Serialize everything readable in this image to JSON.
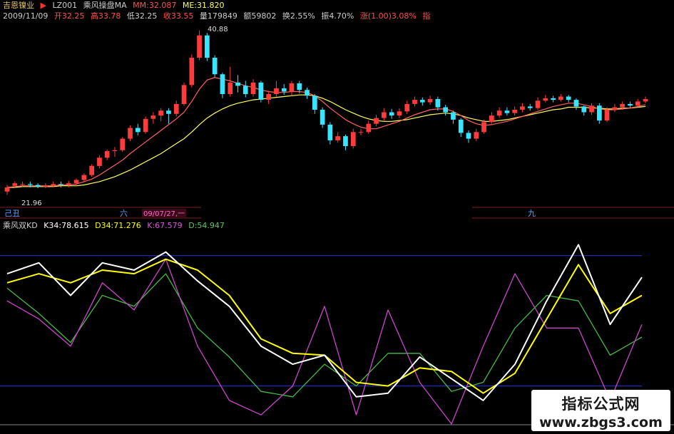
{
  "header": {
    "app": "吉恩镍业",
    "arrow": "▶",
    "code": "LZ001",
    "indicator": "乘风操盘MA",
    "mm": "MM:32.087",
    "me": "ME:31.820",
    "date": "2009/11/09",
    "open": "开32.25",
    "high": "高33.78",
    "low": "低32.25",
    "close": "收33.55",
    "volume": "量179849",
    "amount": "额59802",
    "turnover": "换2.55%",
    "amplitude": "振4.70%",
    "change": "涨(1.00)3.08%",
    "more": "指"
  },
  "price_panel": {
    "high_label": "40.88",
    "low_label": "21.96"
  },
  "separator": {
    "left": "己丑",
    "mid": "六",
    "date_tag": "09/07/27,一",
    "right": "九"
  },
  "kd_header": {
    "name": "乘风双KD",
    "k34": "K34:78.615",
    "d34": "D34:71.276",
    "k": "K:67.579",
    "d": "D:54.947"
  },
  "watermark": {
    "title": "指标公式网",
    "url": "www.zbgs3.com"
  },
  "colors": {
    "up": "#ff3b3b",
    "down": "#39e4ff",
    "ma_fast": "#ff6060",
    "ma_slow": "#ffff60",
    "k34": "#ffffff",
    "d34": "#ffff00",
    "k": "#cc44cc",
    "d": "#44bb44",
    "ref_line": "#1e2bb0"
  },
  "chart_data": [
    {
      "type": "candlestick",
      "title": "乘风操盘MA",
      "ylim": [
        20,
        42
      ],
      "ohlc": [
        [
          21.4,
          21.9,
          21.0,
          22.2
        ],
        [
          22.1,
          22.4,
          21.8,
          22.6
        ],
        [
          22.3,
          22.3,
          22.0,
          22.6
        ],
        [
          22.3,
          22.2,
          21.9,
          22.6
        ],
        [
          22.2,
          22.0,
          21.8,
          22.4
        ],
        [
          22.0,
          22.1,
          21.8,
          22.4
        ],
        [
          22.1,
          22.3,
          21.9,
          22.6
        ],
        [
          22.3,
          22.2,
          21.9,
          22.6
        ],
        [
          22.2,
          22.4,
          21.9,
          22.7
        ],
        [
          22.4,
          22.8,
          22.1,
          23.0
        ],
        [
          22.8,
          23.4,
          22.5,
          23.6
        ],
        [
          23.4,
          24.5,
          23.2,
          24.7
        ],
        [
          24.5,
          25.5,
          24.2,
          25.8
        ],
        [
          25.5,
          26.3,
          25.2,
          26.5
        ],
        [
          26.3,
          26.4,
          25.6,
          26.8
        ],
        [
          26.4,
          27.8,
          26.2,
          28.0
        ],
        [
          27.8,
          29.1,
          27.5,
          29.4
        ],
        [
          29.1,
          28.6,
          28.2,
          29.6
        ],
        [
          28.6,
          30.2,
          28.4,
          30.5
        ],
        [
          30.2,
          30.6,
          29.6,
          31.0
        ],
        [
          30.6,
          31.2,
          29.9,
          31.5
        ],
        [
          31.2,
          30.8,
          29.6,
          31.5
        ],
        [
          30.8,
          32.0,
          30.5,
          32.4
        ],
        [
          32.0,
          34.3,
          31.8,
          34.6
        ],
        [
          34.3,
          37.6,
          34.0,
          38.0
        ],
        [
          37.6,
          40.3,
          37.3,
          40.9
        ],
        [
          40.3,
          37.6,
          37.2,
          40.6
        ],
        [
          37.6,
          35.6,
          35.2,
          37.9
        ],
        [
          35.6,
          33.2,
          32.7,
          35.8
        ],
        [
          33.2,
          34.6,
          32.9,
          36.5
        ],
        [
          34.6,
          34.2,
          33.4,
          35.5
        ],
        [
          34.2,
          33.2,
          32.8,
          34.8
        ],
        [
          33.2,
          34.6,
          32.9,
          35.0
        ],
        [
          34.6,
          32.5,
          32.2,
          34.8
        ],
        [
          32.5,
          33.2,
          32.0,
          33.6
        ],
        [
          33.2,
          33.9,
          32.9,
          34.8
        ],
        [
          33.9,
          33.5,
          33.1,
          34.4
        ],
        [
          33.5,
          34.5,
          33.0,
          34.8
        ],
        [
          34.5,
          33.7,
          33.3,
          34.8
        ],
        [
          33.7,
          33.0,
          32.6,
          34.0
        ],
        [
          33.0,
          31.3,
          30.8,
          33.2
        ],
        [
          31.3,
          29.5,
          29.1,
          31.6
        ],
        [
          29.5,
          27.6,
          27.1,
          29.8
        ],
        [
          27.6,
          28.1,
          27.3,
          28.6
        ],
        [
          28.1,
          26.9,
          26.4,
          28.3
        ],
        [
          26.9,
          28.6,
          26.6,
          29.0
        ],
        [
          28.6,
          28.6,
          28.2,
          29.0
        ],
        [
          28.6,
          29.6,
          28.4,
          30.0
        ],
        [
          29.6,
          30.3,
          29.3,
          30.7
        ],
        [
          30.3,
          31.0,
          30.0,
          31.5
        ],
        [
          31.0,
          30.6,
          30.2,
          31.4
        ],
        [
          30.6,
          31.1,
          30.3,
          31.5
        ],
        [
          31.1,
          32.0,
          30.8,
          32.4
        ],
        [
          32.0,
          32.5,
          31.7,
          32.9
        ],
        [
          32.5,
          32.2,
          31.8,
          32.8
        ],
        [
          32.2,
          32.6,
          31.9,
          33.0
        ],
        [
          32.6,
          31.6,
          31.2,
          32.9
        ],
        [
          31.6,
          31.0,
          30.6,
          31.9
        ],
        [
          31.0,
          30.1,
          29.6,
          31.2
        ],
        [
          30.1,
          28.5,
          28.0,
          30.3
        ],
        [
          28.5,
          27.8,
          27.3,
          28.8
        ],
        [
          27.8,
          28.6,
          27.5,
          29.0
        ],
        [
          28.6,
          29.8,
          28.4,
          30.1
        ],
        [
          29.8,
          30.6,
          29.6,
          31.0
        ],
        [
          30.6,
          31.2,
          30.3,
          31.6
        ],
        [
          31.2,
          30.9,
          30.6,
          31.6
        ],
        [
          30.9,
          31.3,
          30.6,
          31.7
        ],
        [
          31.3,
          31.7,
          31.0,
          32.1
        ],
        [
          31.7,
          31.5,
          31.2,
          32.0
        ],
        [
          31.5,
          32.4,
          31.3,
          32.8
        ],
        [
          32.4,
          32.7,
          32.2,
          33.1
        ],
        [
          32.7,
          32.5,
          32.2,
          33.0
        ],
        [
          32.5,
          32.9,
          32.3,
          33.2
        ],
        [
          32.9,
          32.5,
          32.2,
          33.1
        ],
        [
          32.5,
          31.7,
          31.3,
          32.7
        ],
        [
          31.7,
          31.0,
          30.6,
          31.8
        ],
        [
          31.0,
          31.8,
          30.7,
          32.1
        ],
        [
          31.8,
          30.0,
          29.6,
          32.1
        ],
        [
          30.0,
          31.3,
          29.8,
          31.6
        ],
        [
          31.3,
          31.6,
          31.0,
          32.0
        ],
        [
          31.6,
          32.0,
          31.3,
          32.3
        ],
        [
          32.0,
          31.8,
          31.5,
          32.3
        ],
        [
          31.8,
          32.3,
          31.6,
          32.6
        ],
        [
          32.3,
          32.6,
          32.1,
          32.9
        ]
      ],
      "ma_fast": [
        21.9,
        22.0,
        22.1,
        22.1,
        22.1,
        22.1,
        22.1,
        22.2,
        22.2,
        22.3,
        22.6,
        22.9,
        23.4,
        24.0,
        24.6,
        25.2,
        26.0,
        26.7,
        27.4,
        28.1,
        28.8,
        29.5,
        30.2,
        31.0,
        32.3,
        33.8,
        34.9,
        35.2,
        35.0,
        34.8,
        34.5,
        34.2,
        34.0,
        33.7,
        33.5,
        33.4,
        33.4,
        33.5,
        33.5,
        33.4,
        33.0,
        32.3,
        31.5,
        30.8,
        30.1,
        29.6,
        29.2,
        29.0,
        29.0,
        29.3,
        29.6,
        29.9,
        30.3,
        30.7,
        31.0,
        31.3,
        31.4,
        31.4,
        31.1,
        30.6,
        30.0,
        29.6,
        29.4,
        29.5,
        29.7,
        29.9,
        30.2,
        30.5,
        30.8,
        31.1,
        31.4,
        31.7,
        31.9,
        32.1,
        32.1,
        31.9,
        31.7,
        31.4,
        31.3,
        31.3,
        31.4,
        31.5,
        31.7,
        31.9
      ],
      "ma_slow": [
        21.9,
        21.9,
        22.0,
        22.0,
        22.0,
        22.0,
        22.0,
        22.1,
        22.1,
        22.1,
        22.2,
        22.4,
        22.6,
        22.9,
        23.2,
        23.6,
        24.0,
        24.5,
        25.0,
        25.5,
        26.0,
        26.6,
        27.2,
        27.8,
        28.6,
        29.5,
        30.3,
        30.9,
        31.4,
        31.8,
        32.1,
        32.3,
        32.5,
        32.6,
        32.7,
        32.8,
        32.9,
        33.0,
        33.1,
        33.1,
        33.0,
        32.7,
        32.3,
        31.8,
        31.3,
        30.9,
        30.5,
        30.2,
        30.0,
        29.9,
        29.9,
        30.0,
        30.1,
        30.3,
        30.5,
        30.7,
        30.8,
        30.9,
        30.8,
        30.6,
        30.3,
        30.1,
        29.9,
        29.9,
        30.0,
        30.1,
        30.3,
        30.5,
        30.7,
        30.9,
        31.1,
        31.3,
        31.4,
        31.6,
        31.6,
        31.6,
        31.5,
        31.5,
        31.4,
        31.4,
        31.5,
        31.5,
        31.6,
        31.7
      ],
      "annotations": [
        "40.88",
        "21.96"
      ]
    },
    {
      "type": "line",
      "title": "乘风双KD",
      "ylim": [
        -5,
        106
      ],
      "reference_lines": [
        90,
        18
      ],
      "x": [
        0,
        4,
        8,
        12,
        16,
        20,
        24,
        28,
        32,
        36,
        40,
        44,
        48,
        52,
        56,
        60,
        64,
        68,
        72,
        76,
        80
      ],
      "series": [
        {
          "name": "K34",
          "values": [
            80,
            86,
            68,
            86,
            82,
            92,
            76,
            62,
            40,
            30,
            35,
            12,
            14,
            34,
            22,
            10,
            30,
            65,
            96,
            52,
            78
          ]
        },
        {
          "name": "D34",
          "values": [
            75,
            80,
            75,
            82,
            80,
            88,
            82,
            68,
            44,
            36,
            35,
            20,
            18,
            28,
            26,
            14,
            25,
            55,
            85,
            58,
            68
          ]
        },
        {
          "name": "K",
          "values": [
            65,
            55,
            40,
            75,
            60,
            88,
            40,
            10,
            2,
            18,
            62,
            2,
            60,
            20,
            -3,
            40,
            80,
            50,
            50,
            10,
            52
          ]
        },
        {
          "name": "D",
          "values": [
            72,
            58,
            42,
            68,
            62,
            80,
            50,
            34,
            15,
            12,
            30,
            18,
            36,
            36,
            15,
            20,
            50,
            68,
            65,
            35,
            45
          ]
        }
      ]
    }
  ]
}
